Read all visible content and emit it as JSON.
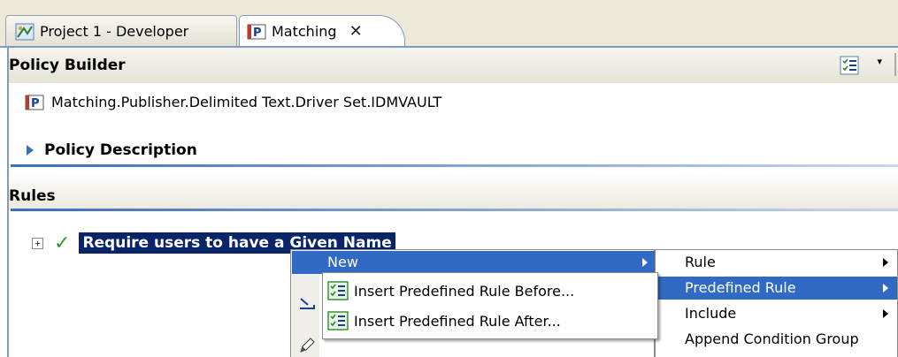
{
  "tabs": [
    {
      "label": "Project 1 - Developer",
      "icon": "project-developer-icon",
      "active": false
    },
    {
      "label": "Matching",
      "icon": "policy-p-icon",
      "active": true,
      "close": "✕"
    }
  ],
  "policy_builder": {
    "title": "Policy Builder",
    "toolbar_icon": "rule-list-icon",
    "dropdown_icon": "▾"
  },
  "policy": {
    "path": "Matching.Publisher.Delimited Text.Driver Set.IDMVAULT",
    "icon": "policy-p-icon"
  },
  "description_section": {
    "label": "Policy Description",
    "expanded": false
  },
  "rules_section": {
    "label": "Rules",
    "rules": [
      {
        "expander": "+",
        "enabled": true,
        "name": "Require users to have a Given Name",
        "selected": true
      }
    ]
  },
  "context_menu": {
    "items": [
      {
        "label": "New",
        "has_submenu": true,
        "highlighted": true
      }
    ],
    "new_submenu": [
      {
        "label": "Rule",
        "has_submenu": true,
        "highlighted": false
      },
      {
        "label": "Predefined Rule",
        "has_submenu": true,
        "highlighted": true
      },
      {
        "label": "Include",
        "has_submenu": true,
        "highlighted": false
      },
      {
        "label": "Append Condition Group",
        "has_submenu": false,
        "highlighted": false
      }
    ],
    "predefined_submenu": [
      {
        "label": "Insert Predefined Rule Before...",
        "icon": "rule-list-icon"
      },
      {
        "label": "Insert Predefined Rule After...",
        "icon": "rule-list-icon"
      }
    ]
  },
  "colors": {
    "selection": "#0a246a",
    "menu_highlight": "#316ac5",
    "accent_line": "#3b6fb6",
    "check": "#2f9a2f"
  }
}
